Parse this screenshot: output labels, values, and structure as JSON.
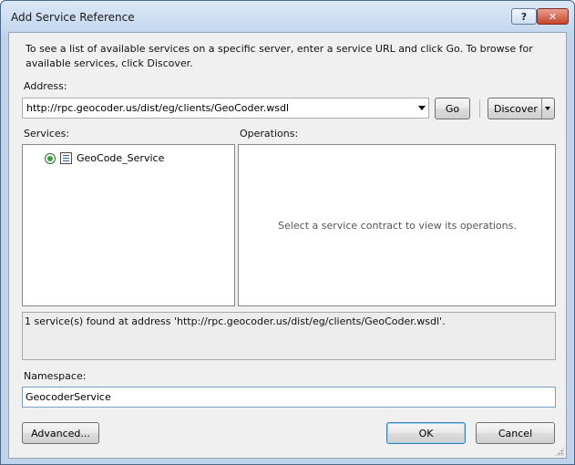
{
  "window": {
    "title": "Add Service Reference",
    "help_glyph": "?",
    "close_glyph": "✕"
  },
  "intro_text": "To see a list of available services on a specific server, enter a service URL and click Go. To browse for available services, click Discover.",
  "address": {
    "label": "Address:",
    "value": "http://rpc.geocoder.us/dist/eg/clients/GeoCoder.wsdl",
    "go_label": "Go",
    "discover_label": "Discover"
  },
  "services": {
    "label": "Services:",
    "items": [
      {
        "label": "GeoCode_Service",
        "selected": true
      }
    ]
  },
  "operations": {
    "label": "Operations:",
    "placeholder": "Select a service contract to view its operations."
  },
  "status_message": "1 service(s) found at address 'http://rpc.geocoder.us/dist/eg/clients/GeoCoder.wsdl'.",
  "namespace": {
    "label": "Namespace:",
    "value": "GeocoderService"
  },
  "buttons": {
    "advanced_label": "Advanced...",
    "ok_label": "OK",
    "cancel_label": "Cancel"
  }
}
